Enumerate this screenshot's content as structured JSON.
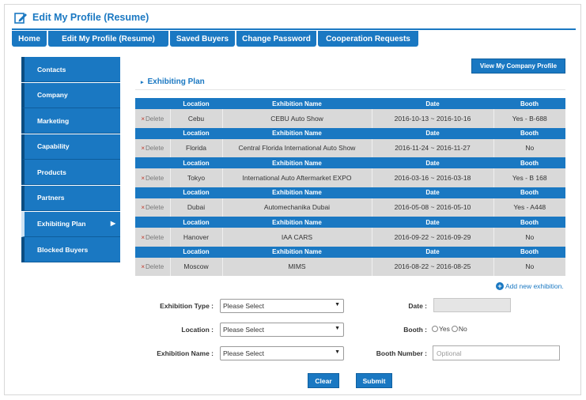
{
  "header": {
    "title": "Edit My Profile (Resume)",
    "icon": "edit-icon"
  },
  "topnav": {
    "tabs": [
      {
        "label": "Home"
      },
      {
        "label": "Edit My Profile (Resume)"
      },
      {
        "label": "Saved Buyers"
      },
      {
        "label": "Change Password"
      },
      {
        "label": "Cooperation Requests"
      }
    ]
  },
  "sidebar": {
    "items": [
      {
        "label": "Contacts"
      },
      {
        "label": "Company"
      },
      {
        "label": "Marketing"
      },
      {
        "label": "Capability"
      },
      {
        "label": "Products"
      },
      {
        "label": "Partners"
      },
      {
        "label": "Exhibiting Plan",
        "active": true
      },
      {
        "label": "Blocked Buyers"
      }
    ],
    "active_arrow": "▶"
  },
  "main": {
    "view_profile_label": "View My Company Profile",
    "section_title": "Exhibiting Plan",
    "section_marker": "▸",
    "table": {
      "headers": {
        "location": "Location",
        "exhibition": "Exhibition Name",
        "date": "Date",
        "booth": "Booth"
      },
      "delete_label": "Delete",
      "delete_mark": "×",
      "rows": [
        {
          "location": "Cebu",
          "exhibition": "CEBU Auto Show",
          "date": "2016-10-13 ~ 2016-10-16",
          "booth": "Yes - B-688"
        },
        {
          "location": "Florida",
          "exhibition": "Central Florida International Auto Show",
          "date": "2016-11-24 ~ 2016-11-27",
          "booth": "No"
        },
        {
          "location": "Tokyo",
          "exhibition": "International Auto Aftermarket EXPO",
          "date": "2016-03-16 ~ 2016-03-18",
          "booth": "Yes - B 168"
        },
        {
          "location": "Dubai",
          "exhibition": "Automechanika Dubai",
          "date": "2016-05-08 ~ 2016-05-10",
          "booth": "Yes - A448"
        },
        {
          "location": "Hanover",
          "exhibition": "IAA CARS",
          "date": "2016-09-22 ~ 2016-09-29",
          "booth": "No"
        },
        {
          "location": "Moscow",
          "exhibition": "MIMS",
          "date": "2016-08-22 ~ 2016-08-25",
          "booth": "No"
        }
      ]
    },
    "add_link": "Add new exhibition.",
    "add_icon": "+",
    "form": {
      "exhibition_type_label": "Exhibition Type :",
      "exhibition_type_value": "Please Select",
      "location_label": "Location :",
      "location_value": "Please Select",
      "exhibition_name_label": "Exhibition Name :",
      "exhibition_name_value": "Please Select",
      "date_label": "Date :",
      "booth_label": "Booth :",
      "booth_yes": "Yes",
      "booth_no": "No",
      "booth_number_label": "Booth Number :",
      "booth_number_placeholder": "Optional",
      "caret": "▼"
    },
    "clear_label": "Clear",
    "submit_label": "Submit"
  },
  "colors": {
    "accent": "#1a78c2",
    "dark_accent": "#0b4d82",
    "row_bg": "#d9d9d9",
    "delete_x": "#c0392b"
  }
}
